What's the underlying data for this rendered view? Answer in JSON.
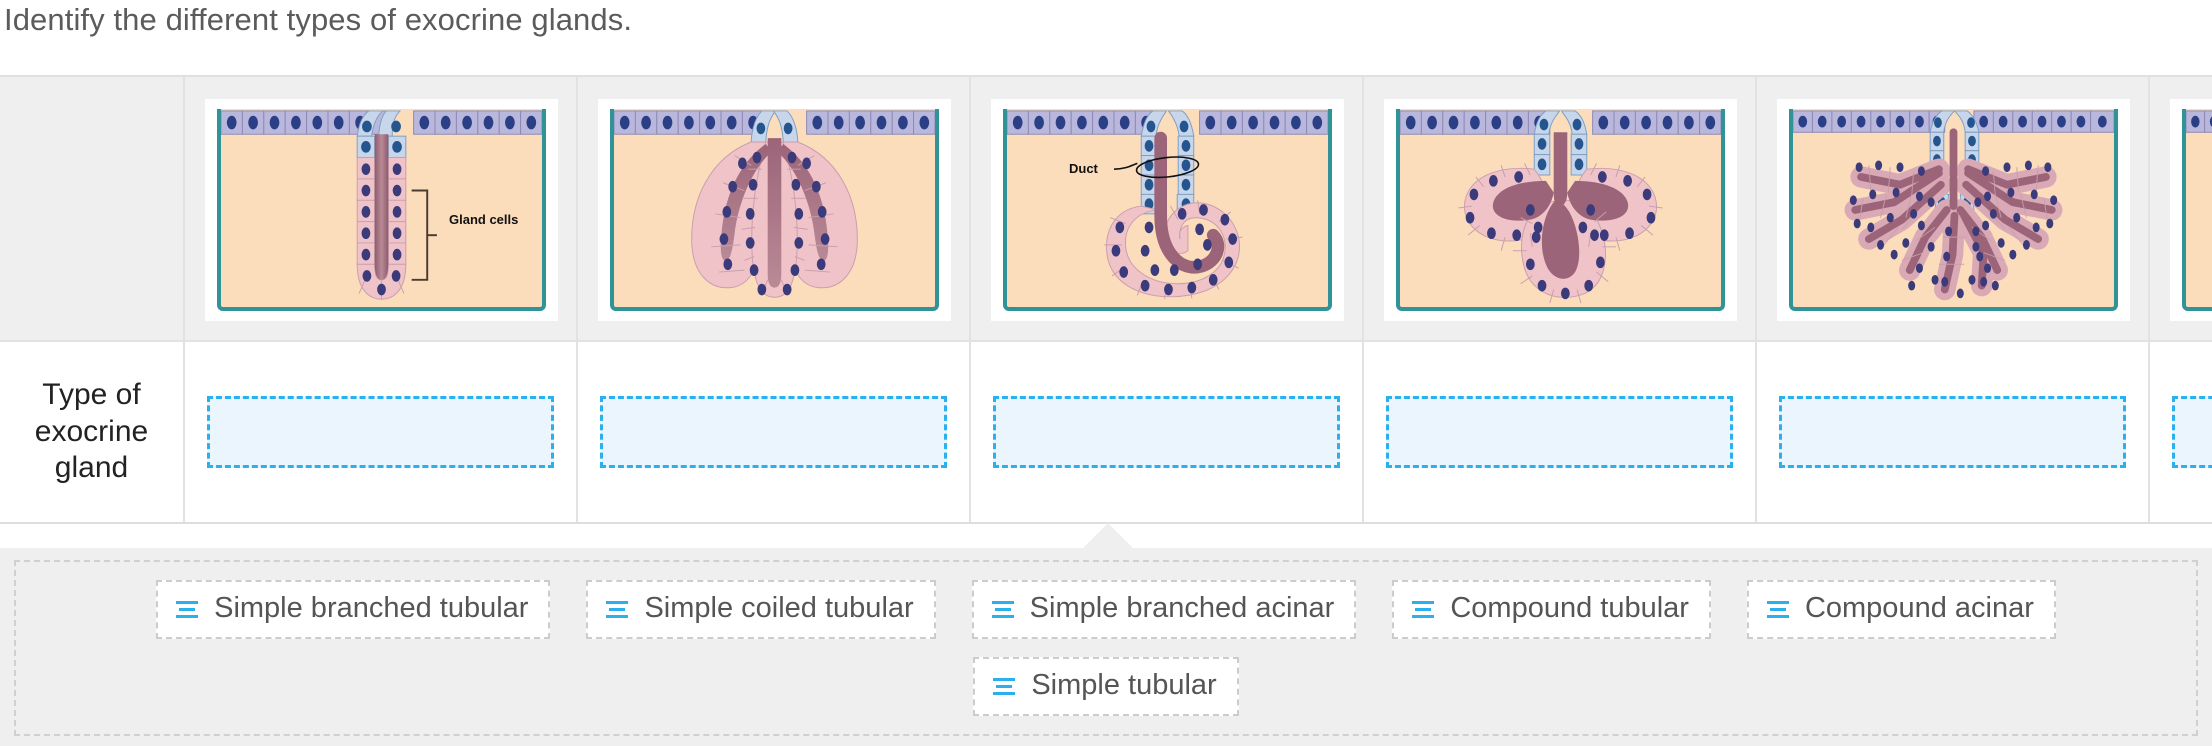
{
  "prompt": "Identify the different types of exocrine glands.",
  "table": {
    "row_label": "Type of exocrine gland",
    "columns": [
      {
        "id": "col-1",
        "diagram": "simple-tubular-gland",
        "annotations": [
          {
            "name": "gland-cells-label",
            "text": "Gland cells"
          }
        ],
        "dropzone_value": ""
      },
      {
        "id": "col-2",
        "diagram": "simple-branched-tubular-gland",
        "annotations": [],
        "dropzone_value": ""
      },
      {
        "id": "col-3",
        "diagram": "simple-coiled-tubular-gland",
        "annotations": [
          {
            "name": "duct-label",
            "text": "Duct"
          }
        ],
        "dropzone_value": ""
      },
      {
        "id": "col-4",
        "diagram": "simple-branched-acinar-gland",
        "annotations": [],
        "dropzone_value": ""
      },
      {
        "id": "col-5",
        "diagram": "compound-tubular-gland",
        "annotations": [],
        "dropzone_value": ""
      },
      {
        "id": "col-6",
        "diagram": "compound-acinar-gland-partial",
        "annotations": [],
        "dropzone_value": ""
      }
    ]
  },
  "answer_bank": {
    "row1": [
      {
        "label": "Simple branched tubular",
        "icon": "drag-handle-icon"
      },
      {
        "label": "Simple coiled tubular",
        "icon": "drag-handle-icon"
      },
      {
        "label": "Simple branched acinar",
        "icon": "drag-handle-icon"
      },
      {
        "label": "Compound tubular",
        "icon": "drag-handle-icon"
      },
      {
        "label": "Compound acinar",
        "icon": "drag-handle-icon"
      }
    ],
    "row2": [
      {
        "label": "Simple tubular",
        "icon": "drag-handle-icon"
      }
    ]
  },
  "colors": {
    "accent": "#2bb0ee",
    "dropzone_fill": "#eaf5fd",
    "tray_bg": "#efefef",
    "panel_tissue": "#fbdcbb",
    "panel_border": "#2f9398",
    "epithelium": "#b9b7dc",
    "gland_cell": "#f0c3c9",
    "lumen": "#9c6479",
    "nucleus": "#3b3a7a"
  }
}
